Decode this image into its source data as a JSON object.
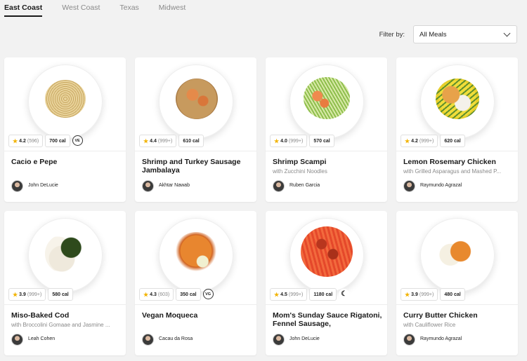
{
  "tabs": [
    {
      "label": "East Coast",
      "active": true
    },
    {
      "label": "West Coast",
      "active": false
    },
    {
      "label": "Texas",
      "active": false
    },
    {
      "label": "Midwest",
      "active": false
    }
  ],
  "filter": {
    "label": "Filter by:",
    "selected": "All Meals"
  },
  "meals": [
    {
      "title": "Cacio e Pepe",
      "subtitle": "",
      "rating": "4.2",
      "count": "(596)",
      "cal": "700 cal",
      "diet": "VE",
      "chef": "John DeLucie"
    },
    {
      "title": "Shrimp and Turkey Sausage Jambalaya",
      "subtitle": "",
      "rating": "4.4",
      "count": "(999+)",
      "cal": "610 cal",
      "diet": "",
      "chef": "Akhtar Nawab"
    },
    {
      "title": "Shrimp Scampi",
      "subtitle": "with Zucchini Noodles",
      "rating": "4.0",
      "count": "(999+)",
      "cal": "570 cal",
      "diet": "",
      "chef": "Ruben Garcia"
    },
    {
      "title": "Lemon Rosemary Chicken",
      "subtitle": "with Grilled Asparagus and Mashed P...",
      "rating": "4.2",
      "count": "(999+)",
      "cal": "620 cal",
      "diet": "",
      "chef": "Raymundo Agrazal"
    },
    {
      "title": "Miso-Baked Cod",
      "subtitle": "with Broccolini Gomaae and Jasmine ...",
      "rating": "3.9",
      "count": "(999+)",
      "cal": "580 cal",
      "diet": "",
      "chef": "Leah Cohen"
    },
    {
      "title": "Vegan Moqueca",
      "subtitle": "",
      "rating": "4.3",
      "count": "(603)",
      "cal": "350 cal",
      "diet": "VG",
      "chef": "Cacau da Rosa"
    },
    {
      "title": "Mom's Sunday Sauce Rigatoni, Fennel Sausage,",
      "subtitle": "",
      "rating": "4.5",
      "count": "(999+)",
      "cal": "1180 cal",
      "diet": "☾",
      "chef": "John DeLucie"
    },
    {
      "title": "Curry Butter Chicken",
      "subtitle": "with Cauliflower Rice",
      "rating": "3.9",
      "count": "(999+)",
      "cal": "480 cal",
      "diet": "",
      "chef": "Raymundo Agrazal"
    }
  ],
  "colors": {
    "accent": "#1a1a1a",
    "star": "#f2b300",
    "background": "#f2f2f2"
  }
}
